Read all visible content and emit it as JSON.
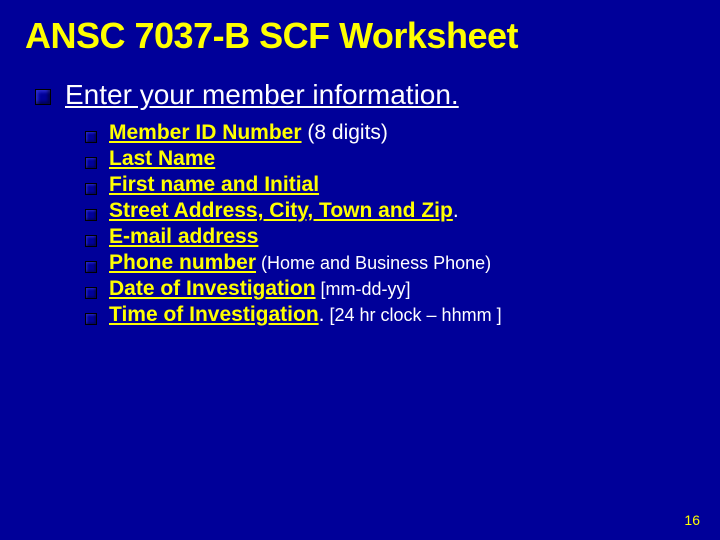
{
  "title": "ANSC 7037-B SCF Worksheet",
  "heading": "Enter your member information.",
  "items": [
    {
      "label": "Member ID Number",
      "note": " (8 digits)",
      "noteSmall": false,
      "period": false
    },
    {
      "label": "Last Name",
      "note": "",
      "noteSmall": false,
      "period": false
    },
    {
      "label": "First name and Initial",
      "note": "",
      "noteSmall": false,
      "period": false
    },
    {
      "label": "Street Address, City, Town and Zip",
      "note": "",
      "noteSmall": false,
      "period": true
    },
    {
      "label": "E-mail address",
      "note": "",
      "noteSmall": false,
      "period": false
    },
    {
      "label": "Phone number",
      "note": " (Home and Business Phone)",
      "noteSmall": true,
      "period": false
    },
    {
      "label": "Date of Investigation",
      "note": " [mm-dd-yy]",
      "noteSmall": true,
      "period": false
    },
    {
      "label": "Time of Investigation",
      "note": " [24 hr clock – hhmm ]",
      "noteSmall": true,
      "period": true
    }
  ],
  "pageNumber": "16"
}
